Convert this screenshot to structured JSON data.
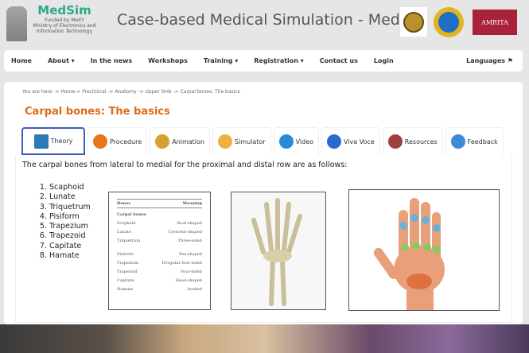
{
  "header": {
    "brand": "MedSim",
    "funded": "Funded by MeitY",
    "ministry": "Ministry of Electronics and Information Technology",
    "title": "Case-based Medical Simulation - MedSIM",
    "partner_logo": "AMRITA"
  },
  "nav": {
    "items": [
      "Home",
      "About ▾",
      "In the news",
      "Workshops",
      "Training ▾",
      "Registration ▾",
      "Contact us",
      "Login"
    ],
    "languages": "Languages ⚑"
  },
  "breadcrumb": "You are here -> Home-> Preclinical -> Anatomy -> Upper limb -> Carpal bones: The basics",
  "page_title": "Carpal bones: The basics",
  "tabs": [
    {
      "label": "Theory",
      "icon": "book-icon",
      "color": "#2a7ab8"
    },
    {
      "label": "Procedure",
      "icon": "refresh-icon",
      "color": "#e8741e"
    },
    {
      "label": "Animation",
      "icon": "palette-icon",
      "color": "#d4a030"
    },
    {
      "label": "Simulator",
      "icon": "simulator-icon",
      "color": "#f0b040"
    },
    {
      "label": "Video",
      "icon": "camera-icon",
      "color": "#2a8ad8"
    },
    {
      "label": "Viva Voce",
      "icon": "question-icon",
      "color": "#2a6ad0"
    },
    {
      "label": "Resources",
      "icon": "books-icon",
      "color": "#a04040"
    },
    {
      "label": "Feedback",
      "icon": "feedback-icon",
      "color": "#3a8ad8"
    }
  ],
  "intro": "The carpal bones from lateral to medial for the proximal and distal row are as follows:",
  "bones": [
    "Scaphoid",
    "Lunate",
    "Triquetrum",
    "Pisiform",
    "Trapezium",
    "Trapezoid",
    "Capitate",
    "Hamate"
  ],
  "table": {
    "headers": [
      "Bones",
      "Meaning"
    ],
    "section": "Carpal bones",
    "rows": [
      [
        "Scaphoid",
        "Boat-shaped"
      ],
      [
        "Lunate",
        "Crescent-shaped"
      ],
      [
        "Triquetrum",
        "Three-sided"
      ],
      [
        "Pisiform",
        "Pea-shaped"
      ],
      [
        "Trapezium",
        "Irregular four-sided"
      ],
      [
        "Trapezoid",
        "Four-sided"
      ],
      [
        "Capitate",
        "Head-shaped"
      ],
      [
        "Hamate",
        "hooked"
      ]
    ]
  }
}
